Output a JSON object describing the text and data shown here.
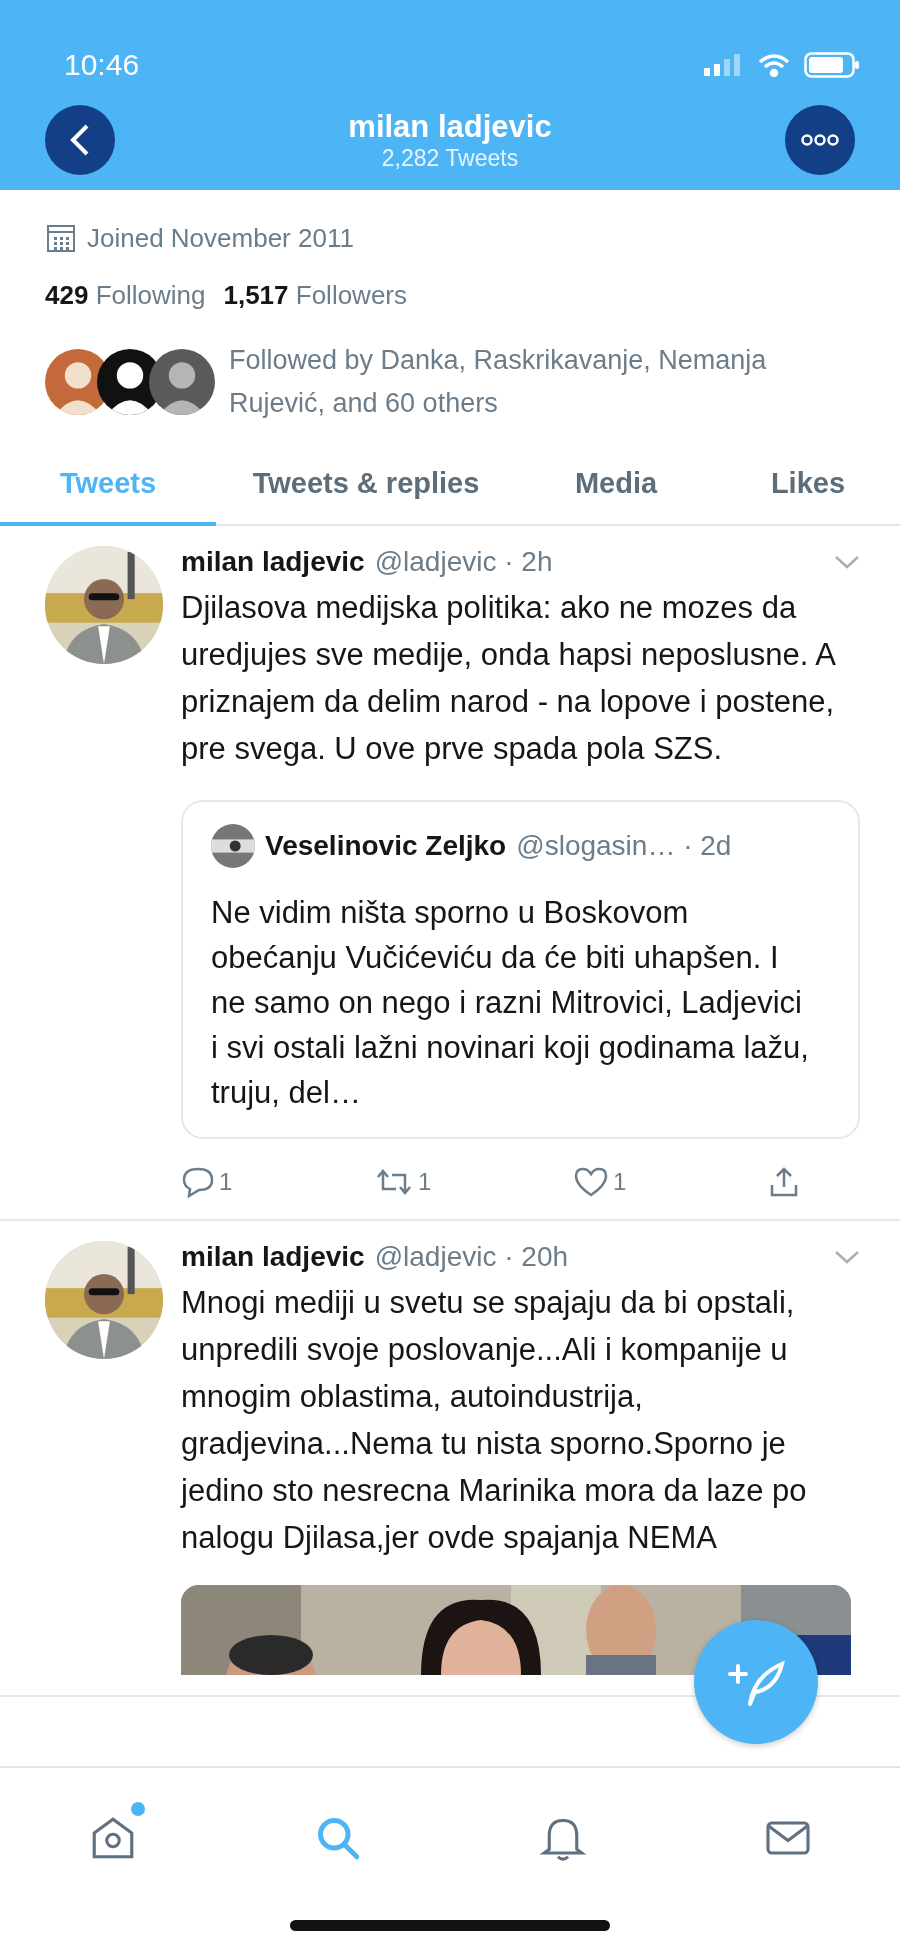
{
  "status_bar": {
    "time": "10:46"
  },
  "header": {
    "title": "milan ladjevic",
    "subtitle": "2,282 Tweets"
  },
  "profile": {
    "joined": "Joined November 2011",
    "following_count": "429",
    "following_label": "Following",
    "followers_count": "1,517",
    "followers_label": "Followers",
    "followed_by": "Followed by Danka, Raskrikavanje, Nemanja Rujević, and 60 others"
  },
  "tabs": [
    {
      "label": "Tweets",
      "selected": true
    },
    {
      "label": "Tweets & replies",
      "selected": false
    },
    {
      "label": "Media",
      "selected": false
    },
    {
      "label": "Likes",
      "selected": false
    }
  ],
  "tweets": [
    {
      "name": "milan ladjevic",
      "meta": "@ladjevic · 2h",
      "text": "Djilasova medijska politika: ako ne mozes da uredjujes sve medije, onda hapsi neposlusne. A priznajem da delim narod - na lopove i postene, pre svega. U ove prve spada pola SZS.",
      "quote": {
        "name": "Veselinovic Zeljko",
        "meta": "@slogasin… · 2d",
        "text": "Ne vidim ništa sporno u Boskovom obećanju Vučićeviću da će biti uhapšen. I ne samo on nego i razni Mitrovici, Ladjevici i svi ostali lažni novinari koji godinama lažu, truju, del…"
      },
      "replies": "1",
      "retweets": "1",
      "likes": "1"
    },
    {
      "name": "milan ladjevic",
      "meta": "@ladjevic · 20h",
      "text": "Mnogi mediji u svetu se spajaju da bi opstali, unpredili svoje poslovanje...Ali i kompanije u mnogim oblastima, autoindustrija, gradjevina...Nema tu nista sporno.Sporno je jedino sto nesrecna Marinika mora da laze po nalogu Djilasa,jer ovde spajanja NEMA"
    }
  ],
  "nav": [
    {
      "kind": "home",
      "selected": false,
      "unread": true
    },
    {
      "kind": "search",
      "selected": true,
      "unread": false
    },
    {
      "kind": "notifications",
      "selected": false,
      "unread": false
    },
    {
      "kind": "messages",
      "selected": false,
      "unread": false
    }
  ]
}
